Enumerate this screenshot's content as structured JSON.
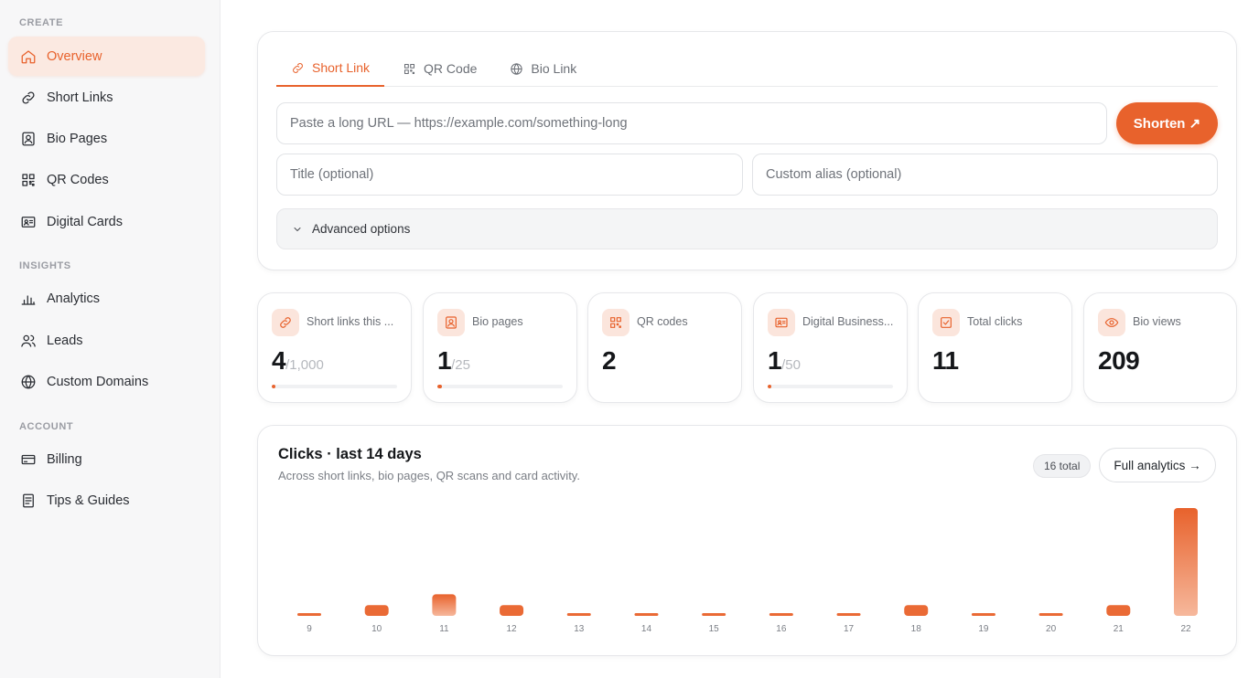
{
  "sidebar": {
    "sections": [
      {
        "label": "CREATE"
      },
      {
        "label": "INSIGHTS"
      },
      {
        "label": "ACCOUNT"
      }
    ],
    "items": [
      {
        "label": "Overview",
        "icon": "home-icon",
        "active": true
      },
      {
        "label": "Short Links",
        "icon": "link-icon"
      },
      {
        "label": "Bio Pages",
        "icon": "bio-page-icon"
      },
      {
        "label": "QR Codes",
        "icon": "qr-code-icon"
      },
      {
        "label": "Digital Cards",
        "icon": "id-card-icon"
      },
      {
        "label": "Analytics",
        "icon": "bar-chart-icon"
      },
      {
        "label": "Leads",
        "icon": "users-icon"
      },
      {
        "label": "Custom Domains",
        "icon": "globe-icon"
      },
      {
        "label": "Billing",
        "icon": "credit-card-icon"
      },
      {
        "label": "Tips & Guides",
        "icon": "document-icon"
      }
    ]
  },
  "create": {
    "tabs": [
      {
        "label": "Short Link",
        "icon": "link-icon",
        "active": true
      },
      {
        "label": "QR Code",
        "icon": "qr-code-icon"
      },
      {
        "label": "Bio Link",
        "icon": "globe-icon"
      }
    ],
    "url_placeholder": "Paste a long URL — https://example.com/something-long",
    "url_value": "",
    "shorten_label": "Shorten ↗",
    "title_placeholder": "Title (optional)",
    "alias_placeholder": "Custom alias (optional)",
    "advanced_label": "Advanced options"
  },
  "stats": [
    {
      "label": "Short links this ...",
      "value": "4",
      "limit": "/1,000",
      "progress": 0.004,
      "icon": "link-icon"
    },
    {
      "label": "Bio pages",
      "value": "1",
      "limit": "/25",
      "progress": 0.04,
      "icon": "bio-page-icon"
    },
    {
      "label": "QR codes",
      "value": "2",
      "limit": "",
      "progress": null,
      "icon": "qr-code-icon"
    },
    {
      "label": "Digital Business...",
      "value": "1",
      "limit": "/50",
      "progress": 0.02,
      "icon": "id-card-icon"
    },
    {
      "label": "Total clicks",
      "value": "11",
      "limit": "",
      "progress": null,
      "icon": "check-square-icon"
    },
    {
      "label": "Bio views",
      "value": "209",
      "limit": "",
      "progress": null,
      "icon": "eye-icon"
    }
  ],
  "clicks": {
    "title": "Clicks · last 14 days",
    "subtitle": "Across short links, bio pages, QR scans and card activity.",
    "total_badge": "16 total",
    "full_analytics_label": "Full analytics →"
  },
  "colors": {
    "accent": "#e8622c",
    "accent_soft": "#fbe9e1"
  },
  "chart_data": {
    "type": "bar",
    "categories": [
      "9",
      "10",
      "11",
      "12",
      "13",
      "14",
      "15",
      "16",
      "17",
      "18",
      "19",
      "20",
      "21",
      "22"
    ],
    "values": [
      0,
      1,
      2,
      1,
      0,
      0,
      0,
      0,
      0,
      1,
      0,
      0,
      1,
      10
    ],
    "xlabel": "",
    "ylabel": "",
    "ylim": [
      0,
      10
    ],
    "grid": false,
    "legend": "none"
  }
}
